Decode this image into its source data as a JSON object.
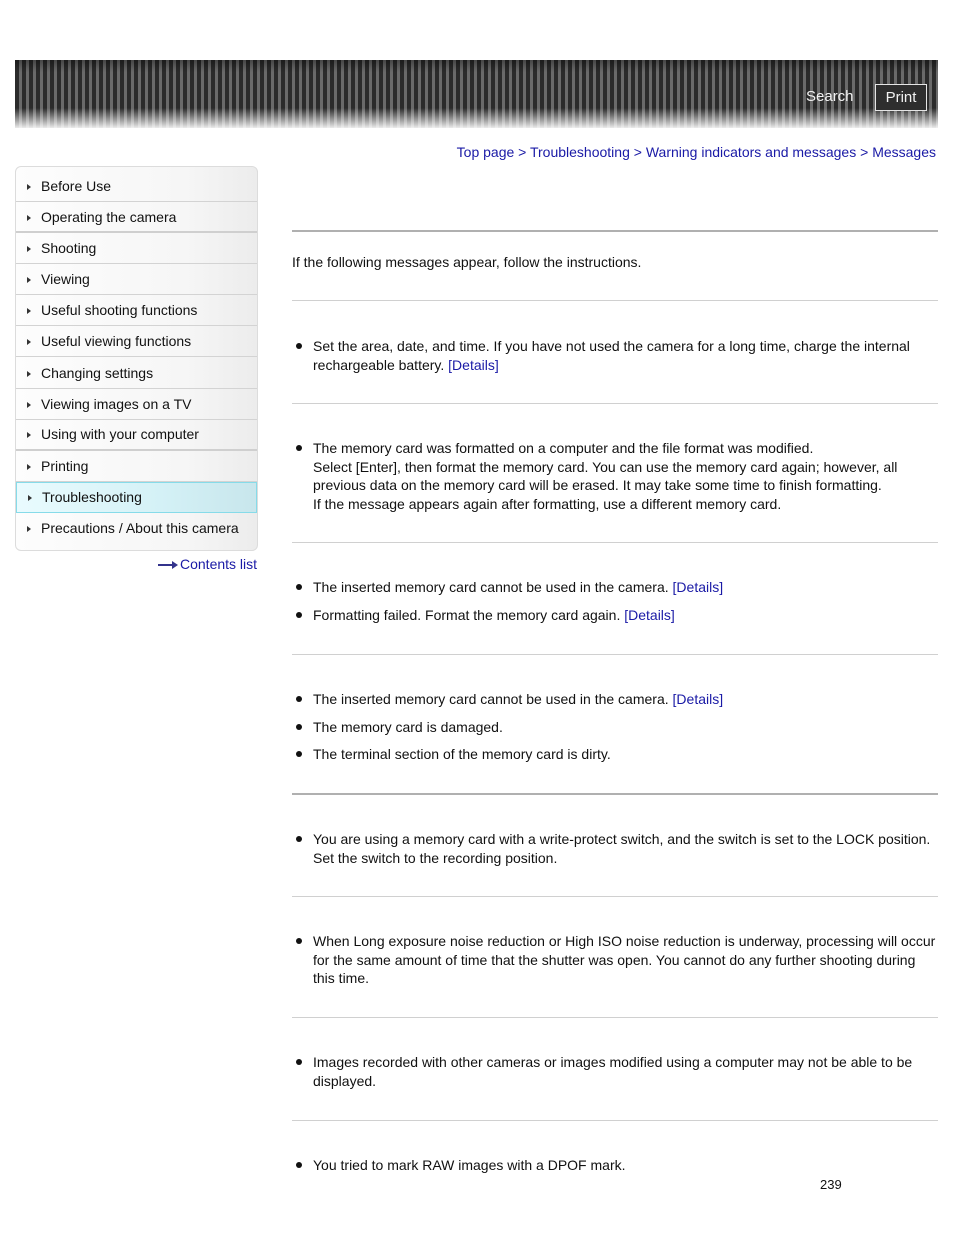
{
  "header": {
    "search_label": "Search",
    "print_label": "Print"
  },
  "breadcrumb": {
    "items": [
      "Top page",
      "Troubleshooting",
      "Warning indicators and messages",
      "Messages"
    ],
    "separator": ">"
  },
  "sidebar": {
    "items": [
      {
        "label": "Before Use"
      },
      {
        "label": "Operating the camera"
      },
      {
        "label": "Shooting"
      },
      {
        "label": "Viewing"
      },
      {
        "label": "Useful shooting functions"
      },
      {
        "label": "Useful viewing functions"
      },
      {
        "label": "Changing settings"
      },
      {
        "label": "Viewing images on a TV"
      },
      {
        "label": "Using with your computer"
      },
      {
        "label": "Printing"
      },
      {
        "label": "Troubleshooting",
        "active": true
      },
      {
        "label": "Precautions / About this camera"
      }
    ],
    "contents_list_label": "Contents list"
  },
  "main": {
    "intro": "If the following messages appear, follow the instructions.",
    "details_label": "[Details]",
    "messages": [
      {
        "text": "Set the area, date, and time. If you have not used the camera for a long time, charge the internal rechargeable battery.",
        "has_details": true
      },
      {
        "text": "The memory card was formatted on a computer and the file format was modified.\nSelect [Enter], then format the memory card. You can use the memory card again; however, all previous data on the memory card will be erased. It may take some time to finish formatting.\nIf the message appears again after formatting, use a different memory card.",
        "has_details": false
      },
      {
        "text": "The inserted memory card cannot be used in the camera.",
        "has_details": true
      },
      {
        "text": "Formatting failed. Format the memory card again.",
        "has_details": true
      },
      {
        "text": "The inserted memory card cannot be used in the camera.",
        "has_details": true
      },
      {
        "text": "The memory card is damaged.",
        "has_details": false
      },
      {
        "text": "The terminal section of the memory card is dirty.",
        "has_details": false
      },
      {
        "text": "You are using a memory card with a write-protect switch, and the switch is set to the LOCK position. Set the switch to the recording position.",
        "has_details": false
      },
      {
        "text": "When Long exposure noise reduction or High ISO noise reduction is underway, processing will occur for the same amount of time that the shutter was open. You cannot do any further shooting during this time.",
        "has_details": false
      },
      {
        "text": "Images recorded with other cameras or images modified using a computer may not be able to be displayed.",
        "has_details": false
      },
      {
        "text": "You tried to mark RAW images with a DPOF mark.",
        "has_details": false
      }
    ]
  },
  "footer": {
    "page_number": "239"
  }
}
